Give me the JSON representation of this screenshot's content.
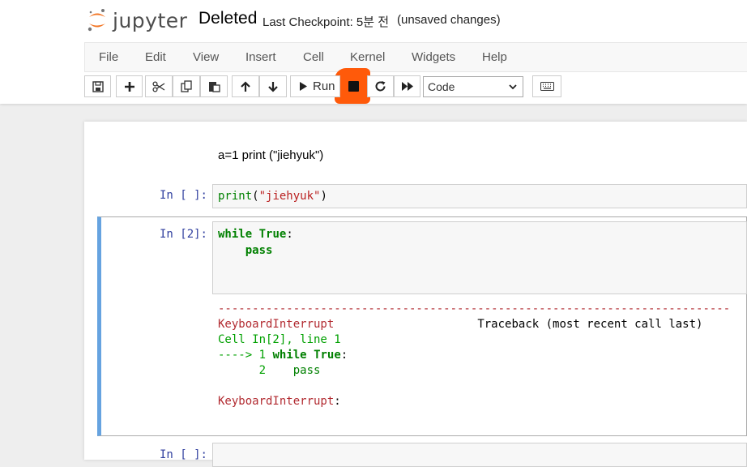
{
  "header": {
    "logo_text": "jupyter",
    "notebook_name": "Deleted",
    "checkpoint": "Last Checkpoint: 5분 전",
    "autosave": "(unsaved changes)"
  },
  "menu": [
    "File",
    "Edit",
    "View",
    "Insert",
    "Cell",
    "Kernel",
    "Widgets",
    "Help"
  ],
  "toolbar": {
    "run_label": "Run",
    "cell_type": "Code",
    "cell_type_options": [
      "Code"
    ],
    "highlight_color": "#ff5a0a"
  },
  "cells": {
    "markdown": "a=1 print (\"jiehyuk\")",
    "cell1": {
      "prompt": "In [ ]:",
      "code_fn": "print",
      "code_open": "(",
      "code_str": "\"jiehyuk\"",
      "code_close": ")"
    },
    "cell2": {
      "prompt": "In [2]:",
      "line1_kw": "while",
      "line1_true": "True",
      "line1_colon": ":",
      "line2": "    pass"
    },
    "output": {
      "rule": "---------------------------------------------------------------------------",
      "exc_name": "KeyboardInterrupt",
      "traceback_header": "Traceback (most recent call last)",
      "cell_line": "Cell In[2], line 1",
      "arrow": "---->",
      "arrow_lineno": "1",
      "arrow_code_kw": "while",
      "arrow_code_true": "True",
      "arrow_colon": ":",
      "line2_no": "2",
      "line2_code": "pass",
      "final_exc": "KeyboardInterrupt",
      "final_colon": ":"
    },
    "cell3": {
      "prompt": "In [ ]:"
    }
  },
  "colors": {
    "prompt_blue": "#303f9f",
    "selected_border": "#66a3e0",
    "keyword_green": "#008000",
    "error_red": "#b22b31"
  }
}
